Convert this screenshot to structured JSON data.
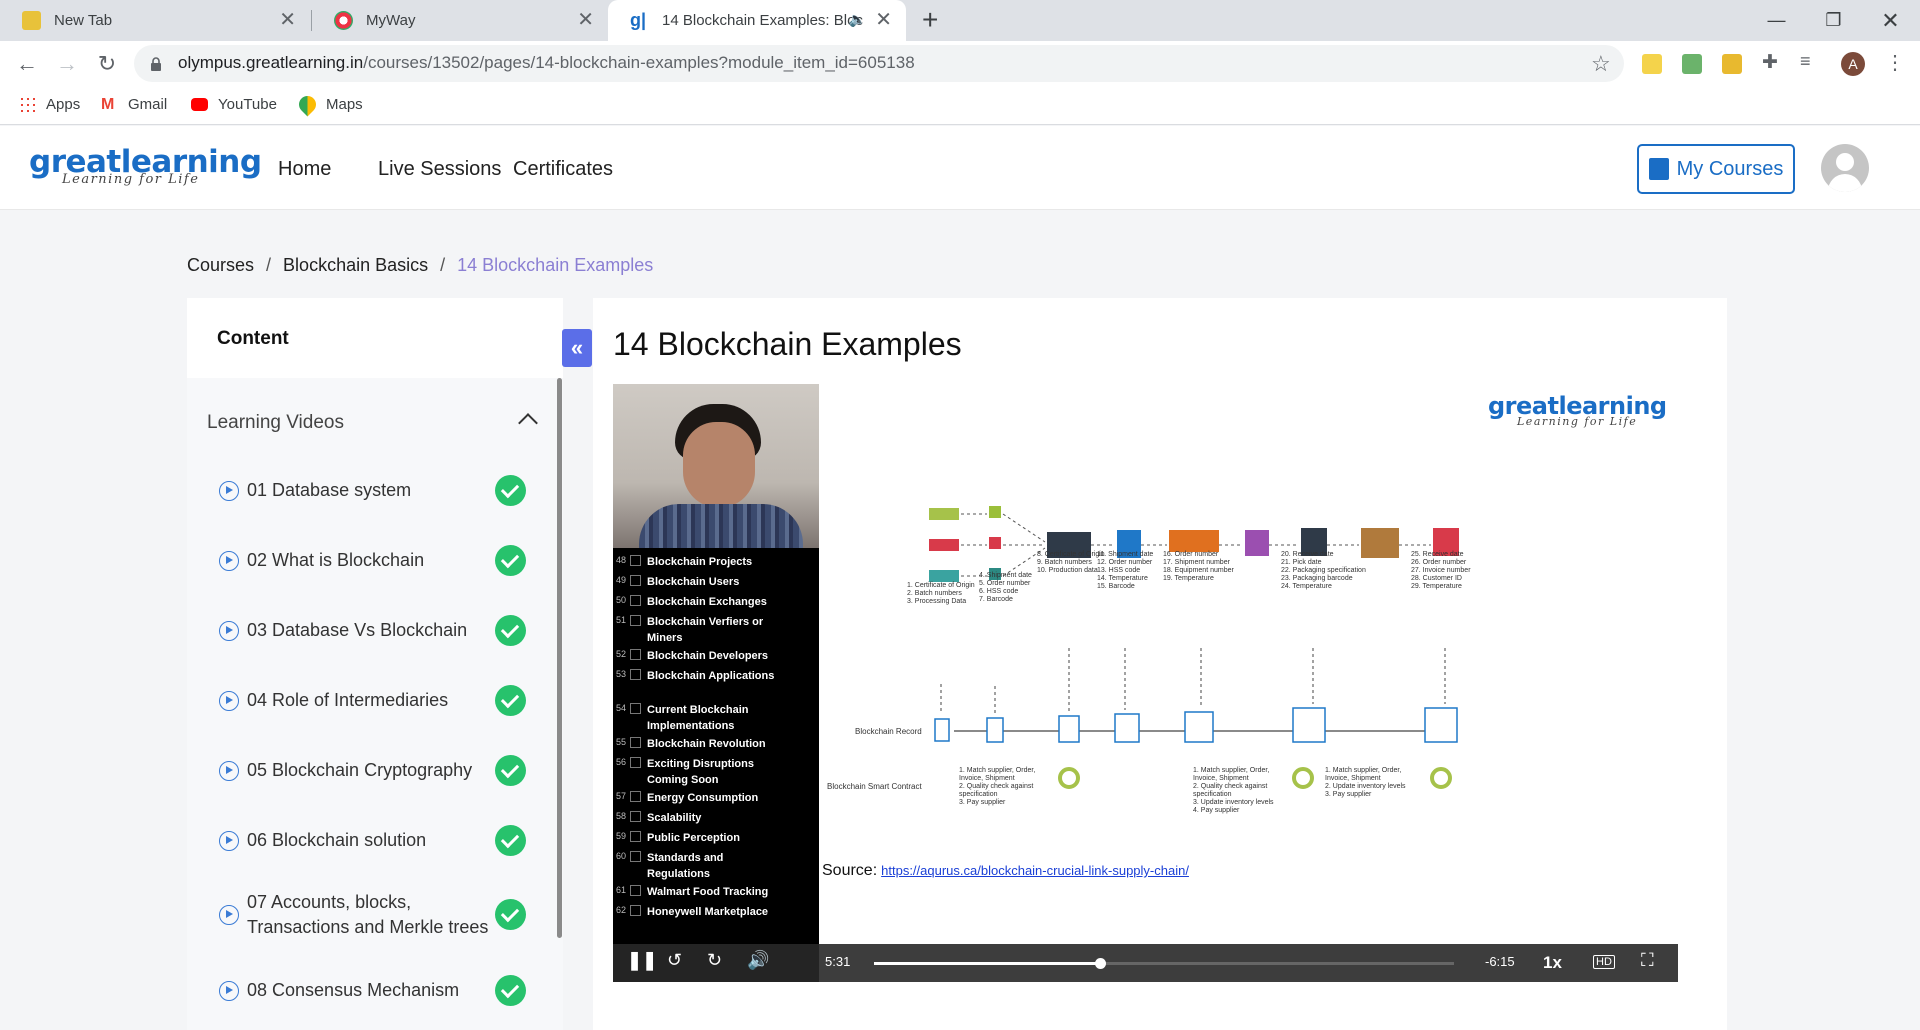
{
  "browser": {
    "tabs": [
      {
        "title": "New Tab"
      },
      {
        "title": "MyWay"
      },
      {
        "title": "14 Blockchain Examples: Bloc"
      }
    ],
    "url_host": "olympus.greatlearning.in",
    "url_path": "/courses/13502/pages/14-blockchain-examples?module_item_id=605138",
    "profile_initial": "A",
    "bookmarks": [
      "Apps",
      "Gmail",
      "YouTube",
      "Maps"
    ]
  },
  "header": {
    "logo_great": "great",
    "logo_learning": "learning",
    "logo_tagline": "Learning for Life",
    "nav": [
      "Home",
      "Live Sessions",
      "Certificates"
    ],
    "my_courses": "My Courses"
  },
  "breadcrumb": {
    "items": [
      "Courses",
      "Blockchain Basics"
    ],
    "current": "14 Blockchain Examples",
    "separator": "/"
  },
  "sidebar": {
    "title": "Content",
    "section": "Learning Videos",
    "items": [
      {
        "label": "01 Database system",
        "completed": true
      },
      {
        "label": "02 What is Blockchain",
        "completed": true
      },
      {
        "label": "03 Database Vs Blockchain",
        "completed": true
      },
      {
        "label": "04 Role of Intermediaries",
        "completed": true
      },
      {
        "label": "05 Blockchain Cryptography",
        "completed": true
      },
      {
        "label": "06 Blockchain solution",
        "completed": true
      },
      {
        "label": "07 Accounts, blocks, Transactions and Merkle trees",
        "completed": true
      },
      {
        "label": "08 Consensus Mechanism",
        "completed": true
      }
    ]
  },
  "main": {
    "title": "14 Blockchain Examples"
  },
  "video": {
    "topics": [
      {
        "n": "48",
        "t": "Blockchain Projects"
      },
      {
        "n": "49",
        "t": "Blockchain Users"
      },
      {
        "n": "50",
        "t": "Blockchain Exchanges"
      },
      {
        "n": "51",
        "t": "Blockchain Verfiers or Miners"
      },
      {
        "n": "52",
        "t": "Blockchain Developers"
      },
      {
        "n": "53",
        "t": "Blockchain Applications"
      },
      {
        "n": "54",
        "t": "Current Blockchain Implementations"
      },
      {
        "n": "55",
        "t": "Blockchain Revolution"
      },
      {
        "n": "56",
        "t": "Exciting Disruptions Coming Soon"
      },
      {
        "n": "57",
        "t": "Energy Consumption"
      },
      {
        "n": "58",
        "t": "Scalability"
      },
      {
        "n": "59",
        "t": "Public Perception"
      },
      {
        "n": "60",
        "t": "Standards and Regulations"
      },
      {
        "n": "61",
        "t": "Walmart Food Tracking"
      },
      {
        "n": "62",
        "t": "Honeywell Marketplace"
      }
    ],
    "slide": {
      "logo_great": "great",
      "logo_learning": "learning",
      "logo_tagline": "Learning for Life",
      "row_record": "Blockchain Record",
      "row_contract": "Blockchain Smart Contract",
      "source_label": "Source:",
      "source_url": "https://aqurus.ca/blockchain-crucial-link-supply-chain/",
      "notes": [
        [
          "1. Certificate of Origin",
          "2. Batch numbers",
          "3. Processing Data"
        ],
        [
          "4. Shipment date",
          "5. Order number",
          "6. HSS code",
          "7. Barcode"
        ],
        [
          "8. Certificate of Origin",
          "9. Batch numbers",
          "10. Production data"
        ],
        [
          "11. Shipment date",
          "12. Order number",
          "13. HSS code",
          "14. Temperature",
          "15. Barcode"
        ],
        [
          "16. Order number",
          "17. Shipment number",
          "18. Equipment number",
          "19. Temperature"
        ],
        [
          "20. Receive date",
          "21. Pick date",
          "22. Packaging specification",
          "23. Packaging barcode",
          "24. Temperature"
        ],
        [
          "25. Receive date",
          "26. Order number",
          "27. Invoice number",
          "28. Customer ID",
          "29. Temperature"
        ]
      ],
      "contracts": [
        [
          "1. Match supplier, Order,",
          "Invoice, Shipment",
          "2. Quality check against",
          "specification",
          "3. Pay supplier"
        ],
        [
          "1. Match supplier, Order,",
          "Invoice, Shipment",
          "2. Quality check against",
          "specification",
          "3. Update inventory levels",
          "4. Pay supplier"
        ],
        [
          "1. Match supplier, Order,",
          "Invoice, Shipment",
          "2. Update inventory levels",
          "3. Pay supplier"
        ]
      ]
    },
    "elapsed": "5:31",
    "remaining": "-6:15",
    "speed": "1x",
    "progress_fraction": 0.39
  },
  "colors": {
    "brand": "#1a6dc5",
    "check": "#27c26c",
    "breadcrumb_current": "#8b7fd3",
    "collapse": "#5b6ee8"
  }
}
